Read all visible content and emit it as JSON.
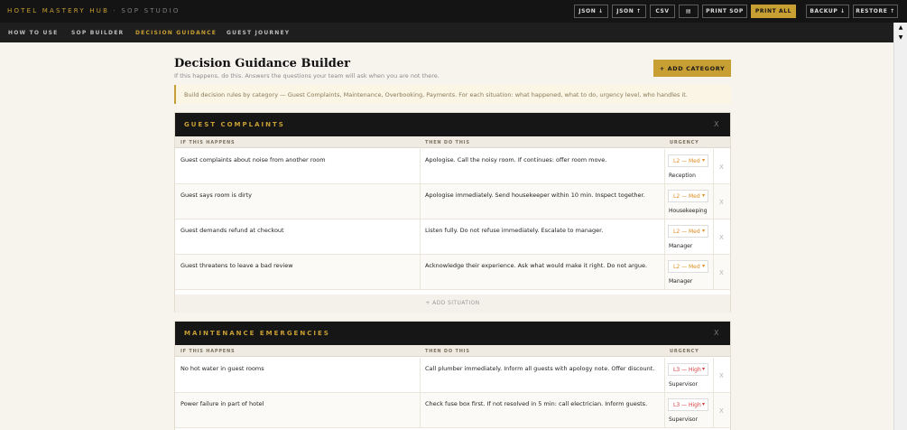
{
  "app": {
    "brand": "HOTEL MASTERY HUB",
    "brand_sub": "· SOP STUDIO"
  },
  "toolbar": {
    "json_down": "JSON ↓",
    "json_up": "JSON ↑",
    "csv": "CSV",
    "print_icon": "▤",
    "print_sop": "PRINT SOP",
    "print_all": "PRINT ALL",
    "backup": "BACKUP ↓",
    "restore": "RESTORE ↑"
  },
  "nav": {
    "items": [
      "HOW TO USE",
      "SOP BUILDER",
      "DECISION GUIDANCE",
      "GUEST JOURNEY"
    ],
    "active": "DECISION GUIDANCE"
  },
  "scrollbar": {
    "up": "▲",
    "down": "▼"
  },
  "page": {
    "title": "Decision Guidance Builder",
    "subtitle": "If this happens, do this. Answers the questions your team will ask when you are not there.",
    "add_category": "+ ADD CATEGORY",
    "info": "Build decision rules by category — Guest Complaints, Maintenance, Overbooking, Payments. For each situation: what happened, what to do, urgency level, who handles it."
  },
  "columns": {
    "if": "IF THIS HAPPENS",
    "then": "THEN DO THIS",
    "urgency": "URGENCY"
  },
  "categories": [
    {
      "title": "GUEST COMPLAINTS",
      "close": "X",
      "add_situation": "+ ADD SITUATION",
      "rows": [
        {
          "if": "Guest complaints about noise from another room",
          "then": "Apologise. Call the noisy room. If continues: offer room move.",
          "urgency": "L2 — Med",
          "owner": "Reception",
          "del": "X"
        },
        {
          "if": "Guest says room is dirty",
          "then": "Apologise immediately. Send housekeeper within 10 min. Inspect together.",
          "urgency": "L2 — Med",
          "owner": "Housekeeping",
          "del": "X"
        },
        {
          "if": "Guest demands refund at checkout",
          "then": "Listen fully. Do not refuse immediately. Escalate to manager.",
          "urgency": "L2 — Med",
          "owner": "Manager",
          "del": "X"
        },
        {
          "if": "Guest threatens to leave a bad review",
          "then": "Acknowledge their experience. Ask what would make it right. Do not argue.",
          "urgency": "L2 — Med",
          "owner": "Manager",
          "del": "X"
        }
      ]
    },
    {
      "title": "MAINTENANCE EMERGENCIES",
      "close": "X",
      "rows": [
        {
          "if": "No hot water in guest rooms",
          "then": "Call plumber immediately. Inform all guests with apology note. Offer discount.",
          "urgency": "L3 — High",
          "owner": "Supervisor",
          "del": "X"
        },
        {
          "if": "Power failure in part of hotel",
          "then": "Check fuse box first. If not resolved in 5 min: call electrician. Inform guests.",
          "urgency": "L3 — High",
          "owner": "Supervisor",
          "del": "X"
        }
      ]
    }
  ],
  "colors": {
    "accent": "#c89f33",
    "dark": "#141414",
    "medium": "#e08a1e",
    "high": "#d83b3b"
  }
}
